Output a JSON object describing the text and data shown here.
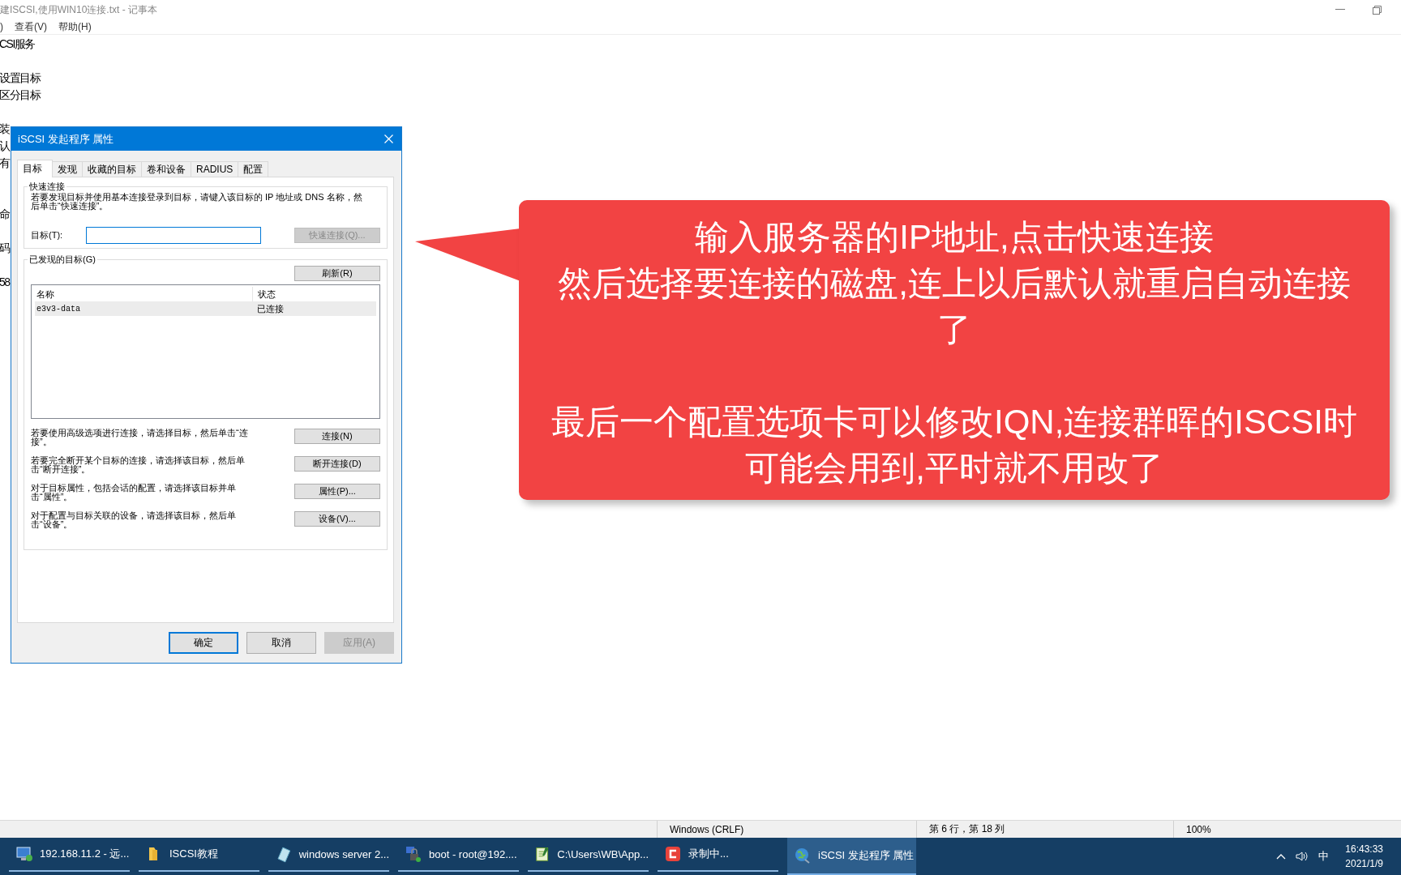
{
  "notepad": {
    "title": "建ISCSI,使用WIN10连接.txt - 记事本",
    "menu": [
      ")",
      "查看(V)",
      "帮助(H)"
    ],
    "paragraphs": [
      [
        "CSI服务"
      ],
      [
        "设置目标",
        "区分目标"
      ],
      [
        "装",
        "认",
        "有"
      ],
      [
        "命"
      ],
      [
        "码"
      ],
      [
        "58"
      ]
    ]
  },
  "dialog": {
    "title": "iSCSI 发起程序 属性",
    "tabs": [
      {
        "label": "目标",
        "selected": true
      },
      {
        "label": "发现",
        "selected": false
      },
      {
        "label": "收藏的目标",
        "selected": false
      },
      {
        "label": "卷和设备",
        "selected": false
      },
      {
        "label": "RADIUS",
        "selected": false
      },
      {
        "label": "配置",
        "selected": false
      }
    ],
    "quick_connect": {
      "legend": "快速连接",
      "description": "若要发现目标并使用基本连接登录到目标，请键入该目标的 IP 地址或 DNS 名称，然后单击“快速连接”。",
      "target_label": "目标(T):",
      "button": {
        "label": "快速连接(Q)...",
        "disabled": true
      }
    },
    "discovered": {
      "legend": "已发现的目标(G)",
      "refresh": "刷新(R)",
      "columns": [
        "名称",
        "状态"
      ],
      "rows": [
        {
          "name": "e3v3-data",
          "status": "已连接",
          "selected": true
        }
      ]
    },
    "actions": [
      {
        "text": "若要使用高级选项进行连接，请选择目标，然后单击“连接”。",
        "button": "连接(N)"
      },
      {
        "text": "若要完全断开某个目标的连接，请选择该目标，然后单击“断开连接”。",
        "button": "断开连接(D)"
      },
      {
        "text": "对于目标属性，包括会话的配置，请选择该目标并单击“属性”。",
        "button": "属性(P)..."
      },
      {
        "text": "对于配置与目标关联的设备，请选择该目标，然后单击“设备”。",
        "button": "设备(V)..."
      }
    ],
    "footer": [
      {
        "label": "确定",
        "default": true,
        "disabled": false
      },
      {
        "label": "取消",
        "default": false,
        "disabled": false
      },
      {
        "label": "应用(A)",
        "default": false,
        "disabled": true
      }
    ]
  },
  "callout": {
    "paragraphs": [
      [
        "输入服务器的IP地址,点击快速连接",
        "然后选择要连接的磁盘,连上以后默认就重启自动连接了"
      ],
      [
        "最后一个配置选项卡可以修改IQN,连接群晖的ISCSI时可能会用到,平时就不用改了"
      ]
    ]
  },
  "status_bar": {
    "encoding": "Windows (CRLF)",
    "position": "第 6 行，第 18 列",
    "zoom": "100%"
  },
  "taskbar": {
    "items": [
      {
        "kind": "remote",
        "label": "192.168.11.2 - 远...",
        "selected": false
      },
      {
        "kind": "folder",
        "label": "ISCSI教程",
        "selected": false
      },
      {
        "kind": "document",
        "label": "windows server 2...",
        "selected": false
      },
      {
        "kind": "terminal",
        "label": "boot - root@192....",
        "selected": false
      },
      {
        "kind": "editor",
        "label": "C:\\Users\\WB\\App...",
        "selected": false
      },
      {
        "kind": "recorder",
        "label": "录制中...",
        "selected": false
      },
      {
        "kind": "globe",
        "label": "iSCSI 发起程序 属性",
        "selected": true
      }
    ],
    "ime": "中",
    "time": "16:43:33",
    "date": "2021/1/9"
  }
}
